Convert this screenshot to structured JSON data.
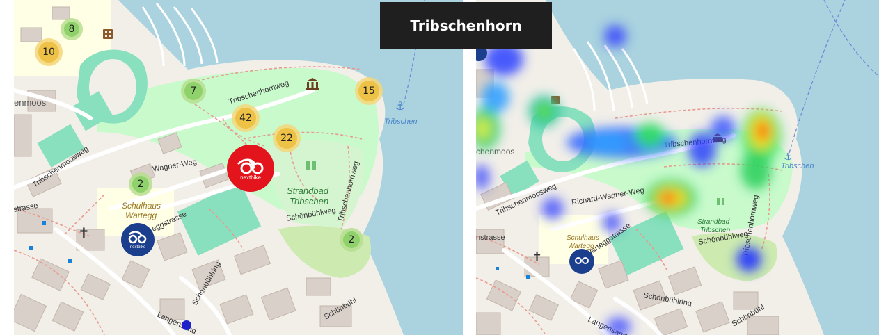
{
  "title": "Tribschenhorn",
  "map_labels": {
    "tribschenhornweg": "Tribschenhornweg",
    "tribschenhornweg_vertical": "Tribschenhornweg",
    "tribschenmoosweg": "Tribschenmoosweg",
    "wagner_weg": "Wagner-Weg",
    "richard_wagner_weg": "Richard-Wagner-Weg",
    "eggstrasse": "eggstrasse",
    "wartegg_strasse": "Warteggstrasse",
    "schonbuhlweg": "Schönbühlweg",
    "schonbuhlring": "Schönbühlring",
    "schonbuhl": "Schönbühl",
    "langensand": "Langensand",
    "tribschen": "Tribschen",
    "strandbad_line1": "Strandbad",
    "strandbad_line2": "Tribschen",
    "schulhaus_line1": "Schulhaus",
    "schulhaus_line2": "Wartegg",
    "enmoos": "enmoos",
    "strasse_left": "strasse",
    "strasse_right": "nstrasse",
    "chenmoos": "chenmoos"
  },
  "clusters": [
    {
      "label": "8",
      "level": "low"
    },
    {
      "label": "10",
      "level": "medium"
    },
    {
      "label": "7",
      "level": "low"
    },
    {
      "label": "15",
      "level": "medium"
    },
    {
      "label": "42",
      "level": "medium"
    },
    {
      "label": "22",
      "level": "medium"
    },
    {
      "label": "2",
      "level": "low"
    },
    {
      "label": "2",
      "level": "low"
    }
  ],
  "stations": {
    "highlighted_brand": "nextbike",
    "regular_brand": "nextbike"
  },
  "colors": {
    "water": "#aad3df",
    "park": "#c8facc",
    "pitch": "#88e0be",
    "school": "#ffffe5",
    "cluster_low_ring": "#b6de8f",
    "cluster_low_fill": "#8fd16a",
    "cluster_medium_ring": "#f4d67a",
    "cluster_medium_fill": "#eec247",
    "station_highlight": "#e3141b",
    "station_regular": "#1b3f8c",
    "title_bg": "#1f1f1f"
  }
}
